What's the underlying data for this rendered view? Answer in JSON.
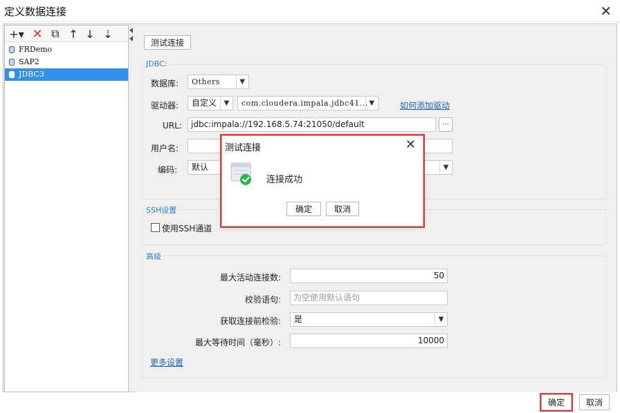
{
  "window": {
    "title": "定义数据连接"
  },
  "left": {
    "toolbar": {
      "add": "+▾",
      "delete": "✕",
      "copy": "⧉",
      "up": "↑",
      "down": "↓",
      "sort": "⇣"
    },
    "connections": [
      {
        "name": "FRDemo",
        "selected": false
      },
      {
        "name": "SAP2",
        "selected": false
      },
      {
        "name": "JDBC3",
        "selected": true
      }
    ]
  },
  "right": {
    "test_button": "测试连接",
    "jdbc": {
      "group_title": "JDBC:",
      "database_label": "数据库:",
      "database_value": "Others",
      "driver_label": "驱动器:",
      "driver_mode": "自定义",
      "driver_class": "com.cloudera.impala.jdbc41...",
      "driver_link": "如何添加驱动",
      "url_label": "URL:",
      "url_value": "jdbc:impala://192.168.5.74:21050/default",
      "url_more": "···",
      "username_label": "用户名:",
      "encoding_label": "编码:",
      "encoding_value": "默认"
    },
    "ssh": {
      "group_title": "SSH设置",
      "use_ssh_label": "使用SSH通道"
    },
    "advanced": {
      "group_title": "高级",
      "max_active_label": "最大活动连接数:",
      "max_active_value": "50",
      "validation_query_label": "校验语句:",
      "validation_query_placeholder": "为空使用默认语句",
      "test_before_label": "获取连接前检验:",
      "test_before_value": "是",
      "max_wait_label": "最大等待时间（毫秒）:",
      "max_wait_value": "10000",
      "more_settings": "更多设置"
    }
  },
  "footer": {
    "ok": "确定",
    "cancel": "取消"
  },
  "dialog": {
    "title": "测试连接",
    "message": "连接成功",
    "ok": "确定",
    "cancel": "取消"
  },
  "colors": {
    "highlight": "#e03b3b",
    "selected": "#3390ea",
    "accent": "#2c7fc7",
    "success": "#2ab548"
  }
}
